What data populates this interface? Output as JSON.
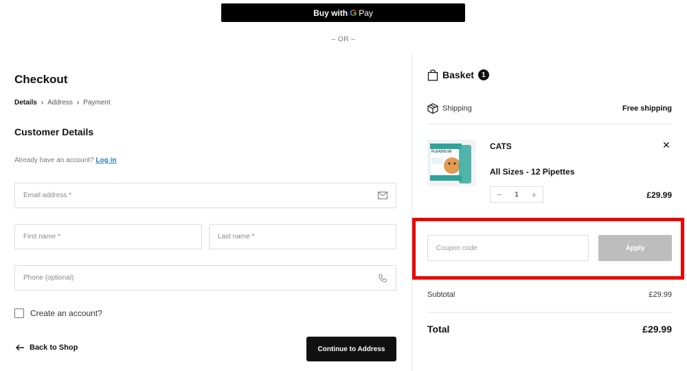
{
  "gpay": {
    "prefix": "Buy with",
    "g": "G",
    "pay": "Pay"
  },
  "or_text": "– OR –",
  "checkout": {
    "title": "Checkout",
    "breadcrumb": {
      "step1": "Details",
      "step2": "Address",
      "step3": "Payment"
    },
    "section_title": "Customer Details",
    "login_prompt": "Already have an account?",
    "login_link": "Log in",
    "email_placeholder": "Email address *",
    "first_name_placeholder": "First name *",
    "last_name_placeholder": "Last name *",
    "phone_placeholder": "Phone (optional)",
    "create_account_label": "Create an account?",
    "back_label": "Back to Shop",
    "continue_label": "Continue to Address"
  },
  "basket": {
    "title": "Basket",
    "count": "1",
    "shipping_label": "Shipping",
    "shipping_value": "Free shipping",
    "item": {
      "name": "CATS",
      "variant": "All Sizes - 12 Pipettes",
      "quantity": "1",
      "price": "£29.99",
      "image_brand_text": "FLEASOLVE"
    },
    "coupon_placeholder": "Coupon code",
    "apply_label": "Apply",
    "subtotal_label": "Subtotal",
    "subtotal_value": "£29.99",
    "total_label": "Total",
    "total_value": "£29.99"
  },
  "colors": {
    "accent_highlight": "#ee0000",
    "link": "#2a7ab8",
    "button_dark": "#111111",
    "apply_disabled": "#bdbdbd"
  }
}
